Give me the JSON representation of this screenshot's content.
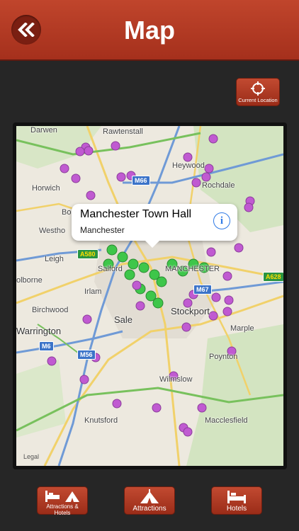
{
  "header": {
    "title": "Map",
    "back_icon": "double-chevron-left-icon"
  },
  "current_location": {
    "label": "Current Location",
    "icon": "crosshair-icon"
  },
  "map": {
    "places": {
      "darwen": "Darwen",
      "rawtenstall": "Rawtenstall",
      "heywood": "Heywood",
      "horwich": "Horwich",
      "rochdale": "Rochdale",
      "bolton": "Bo",
      "westhoughton": "Westho",
      "leigh": "Leigh",
      "salford": "Salford",
      "manchester": "MANCHESTER",
      "golborne": "olborne",
      "irlam": "Irlam",
      "birchwood": "Birchwood",
      "sale": "Sale",
      "stockport": "Stockport",
      "marple": "Marple",
      "warrington": "Warrington",
      "poynton": "Poynton",
      "wilmslow": "Wilmslow",
      "knutsford": "Knutsford",
      "macclesfield": "Macclesfield"
    },
    "shields": {
      "m66": "M66",
      "a580": "A580",
      "m67": "M67",
      "a628": "A628",
      "m6": "M6",
      "m56": "M56"
    },
    "legal": "Legal",
    "callout": {
      "title": "Manchester Town Hall",
      "subtitle": "Manchester",
      "info_icon": "info-icon"
    }
  },
  "tabs": [
    {
      "label": "Attractions & Hotels",
      "icon": "bed-and-tent-icon"
    },
    {
      "label": "Attractions",
      "icon": "tent-icon"
    },
    {
      "label": "Hotels",
      "icon": "bed-icon"
    }
  ],
  "colors": {
    "header": "#b23a22",
    "pin_purple": "#c05ad1",
    "pin_green": "#3ec64a",
    "map_bg": "#ede9df"
  }
}
